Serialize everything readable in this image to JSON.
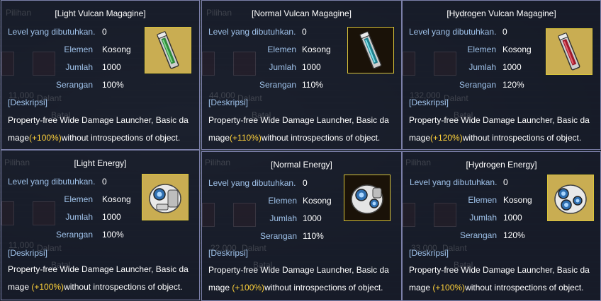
{
  "panels": [
    {
      "title": "[Light Vulcan Magagine]",
      "level_label": "Level yang dibutuhkan.",
      "level_value": "0",
      "element_label": "Elemen",
      "element_value": "Kosong",
      "qty_label": "Jumlah",
      "qty_value": "1000",
      "attack_label": "Serangan",
      "attack_value": "100%",
      "desc_header": "[Deskripsi]",
      "desc_line1": "Property-free Wide Damage Launcher, Basic da",
      "desc_pre": "mage",
      "desc_hl": "(+100%)",
      "desc_post": "without introspections of object.",
      "icon": "green-magazine-icon",
      "bg_labels": [
        "Pilihan",
        "11,000",
        "Dalant",
        "Batal"
      ]
    },
    {
      "title": "[Normal Vulcan Magagine]",
      "level_label": "Level yang dibutuhkan.",
      "level_value": "0",
      "element_label": "Elemen",
      "element_value": "Kosong",
      "qty_label": "Jumlah",
      "qty_value": "1000",
      "attack_label": "Serangan",
      "attack_value": "110%",
      "desc_header": "[Deskripsi]",
      "desc_line1": "Property-free Wide Damage Launcher, Basic da",
      "desc_pre": "mage",
      "desc_hl": "(+110%)",
      "desc_post": "without introspections of object.",
      "icon": "cyan-magazine-icon",
      "bg_labels": [
        "Pilihan",
        "44,000",
        "Dalant",
        "Batal"
      ]
    },
    {
      "title": "[Hydrogen Vulcan Magagine]",
      "level_label": "Level yang dibutuhkan.",
      "level_value": "0",
      "element_label": "Elemen",
      "element_value": "Kosong",
      "qty_label": "Jumlah",
      "qty_value": "1000",
      "attack_label": "Serangan",
      "attack_value": "120%",
      "desc_header": "[Deskripsi]",
      "desc_line1": "Property-free Wide Damage Launcher, Basic da",
      "desc_pre": "mage",
      "desc_hl": "(+120%)",
      "desc_post": "without introspections of object.",
      "icon": "red-magazine-icon",
      "bg_labels": [
        "Pilihan",
        "132,000",
        "Dalant",
        "Batal"
      ]
    },
    {
      "title": "[Light Energy]",
      "level_label": "Level yang dibutuhkan.",
      "level_value": "0",
      "element_label": "Elemen",
      "element_value": "Kosong",
      "qty_label": "Jumlah",
      "qty_value": "1000",
      "attack_label": "Serangan",
      "attack_value": "100%",
      "desc_header": "[Deskripsi]",
      "desc_line1": "Property-free Wide Damage Launcher, Basic da",
      "desc_pre": "mage ",
      "desc_hl": "(+100%)",
      "desc_post": "without introspections of object.",
      "icon": "energy-cell-icon",
      "bg_labels": [
        "Pilihan",
        "11,000",
        "Dalant",
        "Batal"
      ]
    },
    {
      "title": "[Normal Energy]",
      "level_label": "Level yang dibutuhkan.",
      "level_value": "0",
      "element_label": "Elemen",
      "element_value": "Kosong",
      "qty_label": "Jumlah",
      "qty_value": "1000",
      "attack_label": "Serangan",
      "attack_value": "110%",
      "desc_header": "[Deskripsi]",
      "desc_line1": "Property-free Wide Damage Launcher, Basic da",
      "desc_pre": "mage ",
      "desc_hl": "(+100%)",
      "desc_post": "without introspections of object.",
      "icon": "energy-cell-icon",
      "bg_labels": [
        "Pilihan",
        "22,000",
        "Dalant",
        "Batal"
      ]
    },
    {
      "title": "[Hydrogen Energy]",
      "level_label": "Level yang dibutuhkan.",
      "level_value": "0",
      "element_label": "Elemen",
      "element_value": "Kosong",
      "qty_label": "Jumlah",
      "qty_value": "1000",
      "attack_label": "Serangan",
      "attack_value": "120%",
      "desc_header": "[Deskripsi]",
      "desc_line1": "Property-free Wide Damage Launcher, Basic da",
      "desc_pre": "mage ",
      "desc_hl": "(+100%)",
      "desc_post": "without introspections of object.",
      "icon": "energy-cell-icon",
      "bg_labels": [
        "Pilihan",
        "33,000",
        "Dalant",
        "Batal"
      ]
    }
  ],
  "colors": {
    "label": "#9fc2ea",
    "value": "#ffffff",
    "highlight": "#ffd23a",
    "border": "#7b7fa8",
    "icon_frame": "#d8c43a"
  }
}
